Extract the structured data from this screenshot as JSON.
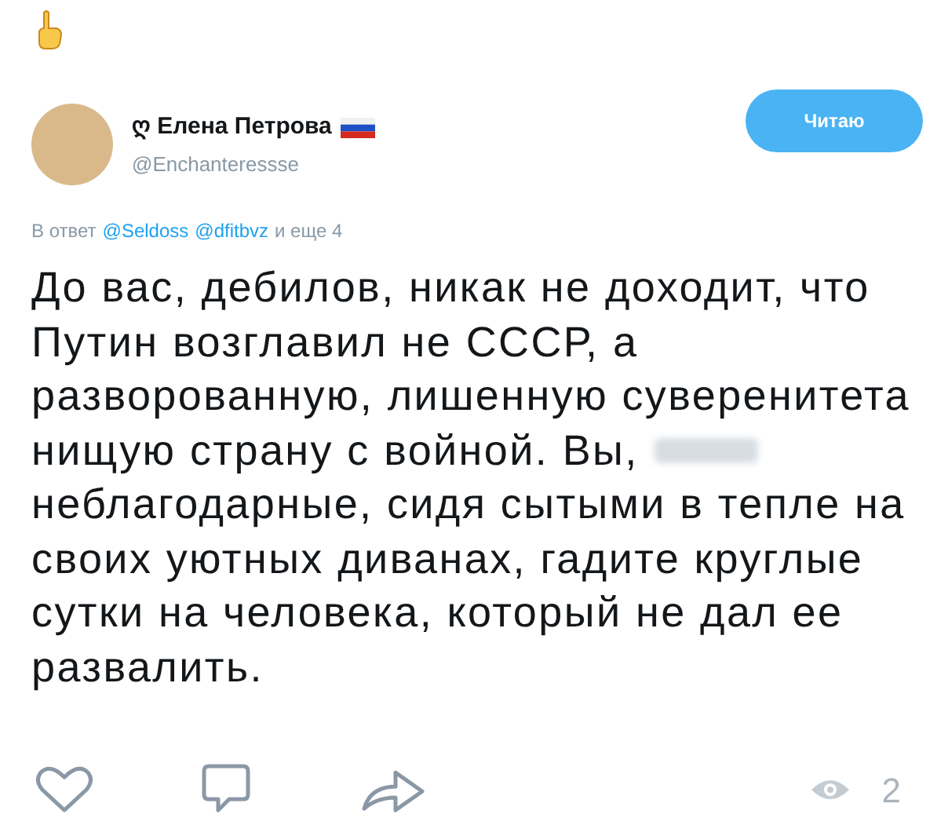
{
  "author": {
    "name": "ღ Елена Петрова",
    "handle": "@Enchanteressse"
  },
  "follow_button": {
    "label": "Читаю"
  },
  "reply_to": {
    "prefix": "В ответ",
    "mentions": [
      "@Seldoss",
      "@dfitbvz"
    ],
    "suffix": "и еще 4"
  },
  "body": [
    {
      "text": "До вас, дебилов, никак не доходит, что",
      "redacted_after": false
    },
    {
      "text": "Путин возглавил не СССР, а",
      "redacted_after": false
    },
    {
      "text": "разворованную, лишенную суверенитета",
      "redacted_after": false
    },
    {
      "text": "нищую страну с войной. Вы,",
      "redacted_after": true
    },
    {
      "text": "неблагодарные, сидя сытыми в тепле на",
      "redacted_after": false
    },
    {
      "text": "своих уютных диванах, гадите круглые",
      "redacted_after": false
    },
    {
      "text": "сутки на человека, который не дал ее",
      "redacted_after": false
    },
    {
      "text": "развалить.",
      "redacted_after": false
    }
  ],
  "views": "2"
}
